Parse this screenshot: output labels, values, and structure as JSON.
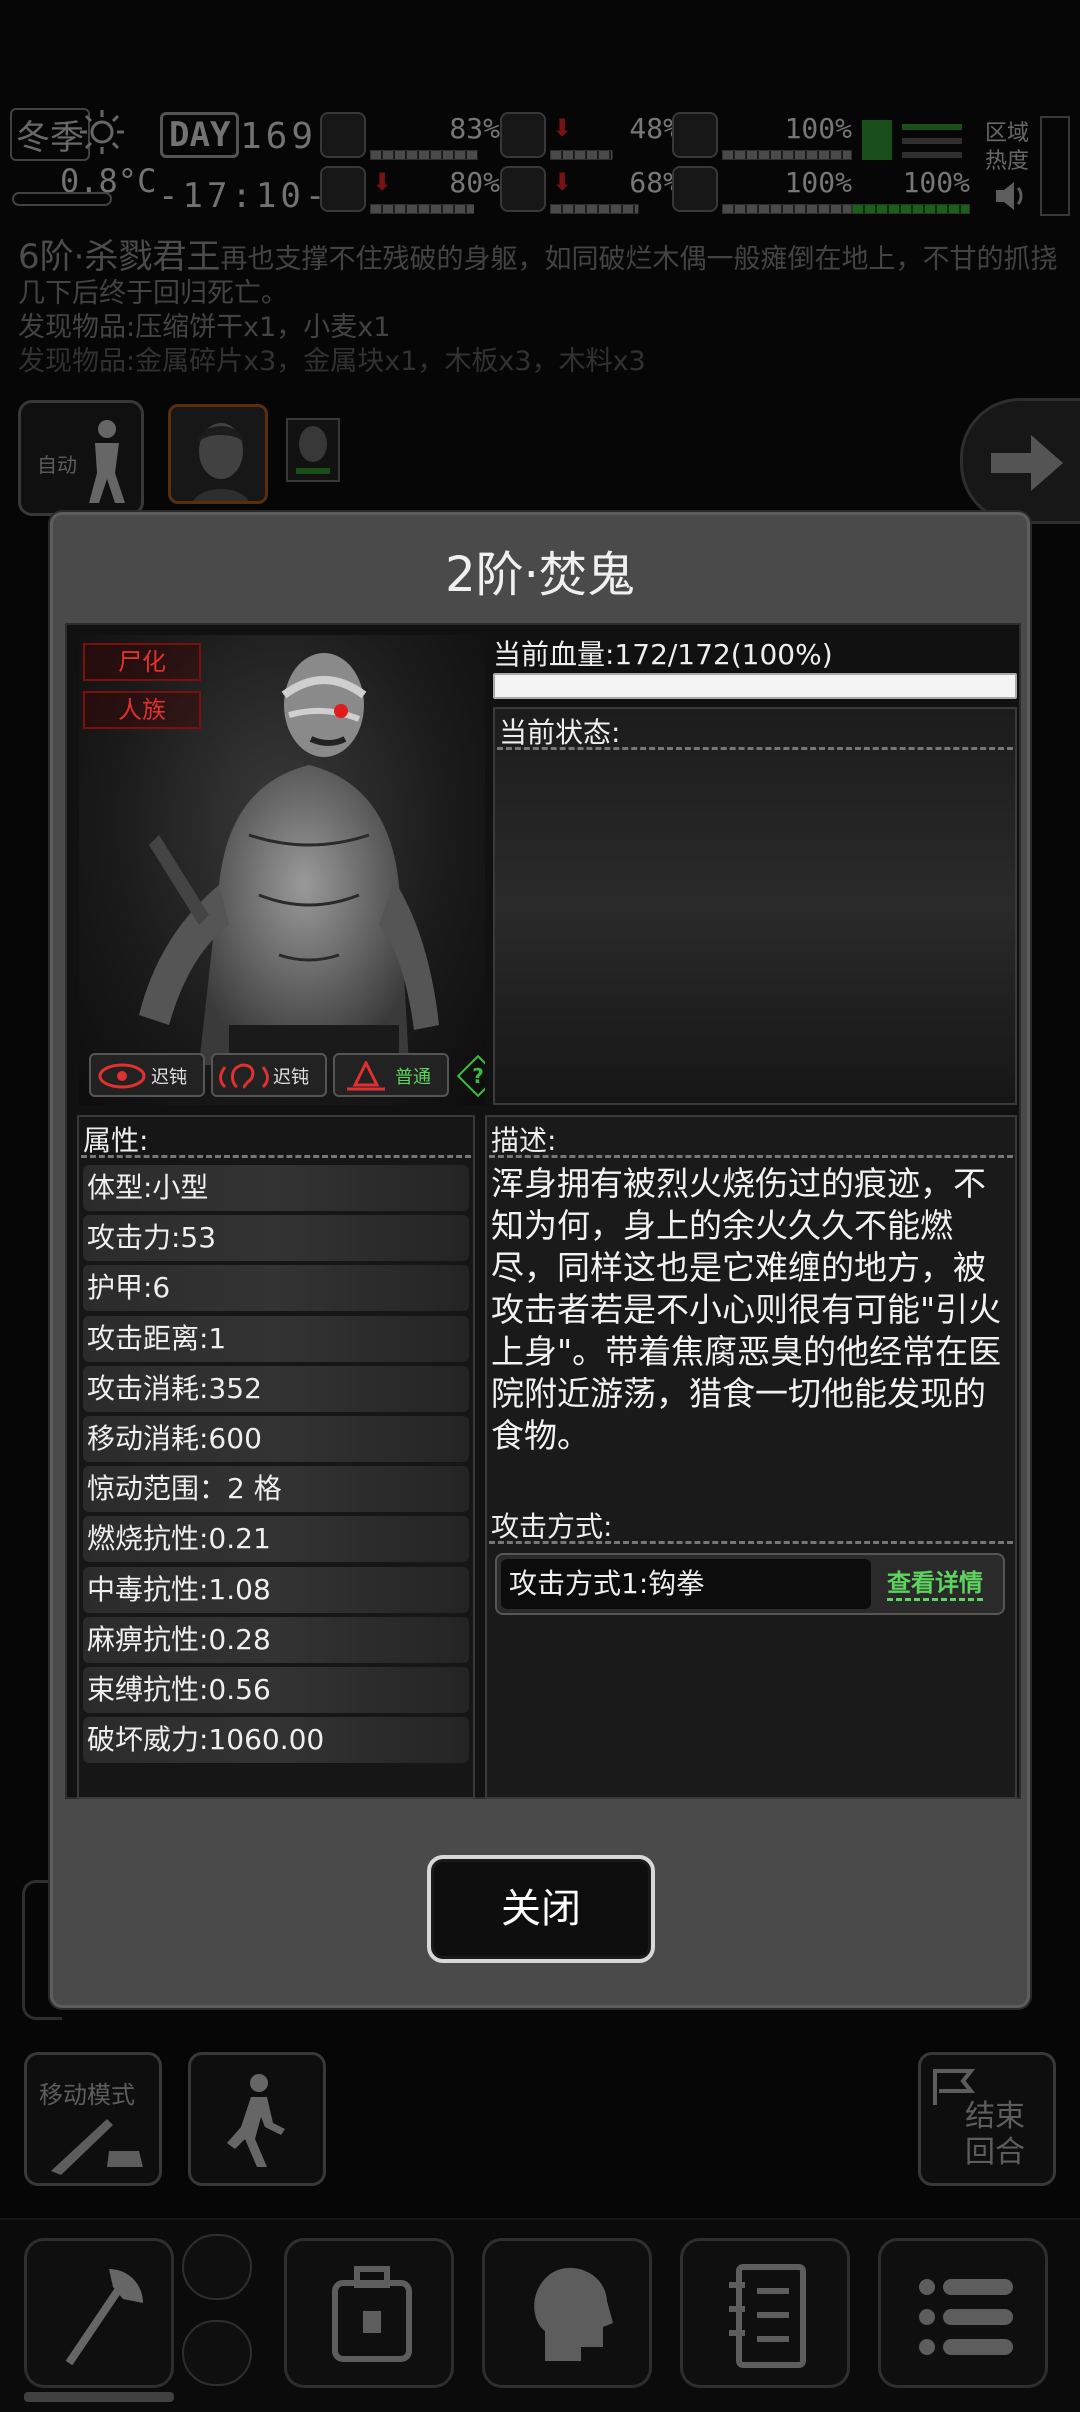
{
  "hud": {
    "season": "冬季",
    "temperature": "0.8°C",
    "day_label": "DAY",
    "day_number": "169",
    "clock": "-17:10-",
    "stats": [
      {
        "icon": "medkit-icon",
        "value": "83%",
        "level": 0.83,
        "trend": ""
      },
      {
        "icon": "stomach-icon",
        "value": "48%",
        "level": 0.48,
        "trend": "down"
      },
      {
        "icon": "stamina-icon",
        "value": "100%",
        "level": 1.0,
        "trend": ""
      },
      {
        "icon": "eye-icon",
        "value": "80%",
        "level": 0.8,
        "trend": "down"
      },
      {
        "icon": "water-drop-icon",
        "value": "68%",
        "level": 0.68,
        "trend": "down"
      },
      {
        "icon": "heart-icon",
        "value": "100%",
        "level": 1.0,
        "trend": ""
      },
      {
        "icon": "green-status-icon",
        "value": "100%",
        "level": 1.0,
        "trend": ""
      }
    ],
    "zone_heat_label": "区域热度"
  },
  "log": {
    "enemy_name": "6阶·杀戮君王",
    "message": "再也支撑不住残破的身躯，如同破烂木偶一般瘫倒在地上，不甘的抓挠几下后终于回归死亡。",
    "found_1": "发现物品:压缩饼干x1，小麦x1",
    "found_2": "发现物品:金属碎片x3，金属块x1，木板x3，木料x3"
  },
  "combat": {
    "auto_label": "自动"
  },
  "controls": {
    "move_mode_label": "移动模式",
    "end_turn_label": "结束回合"
  },
  "modal": {
    "title": "2阶·焚鬼",
    "tags": [
      "尸化",
      "人族"
    ],
    "senses": [
      {
        "icon": "eye-icon",
        "label": "迟钝"
      },
      {
        "icon": "ear-icon",
        "label": "迟钝"
      },
      {
        "icon": "nose-icon",
        "label": "普通"
      }
    ],
    "help_icon": "?",
    "hp_label": "当前血量:172/172(100%)",
    "hp_fraction": 1.0,
    "status_label": "当前状态:",
    "attributes_label": "属性:",
    "attributes": [
      "体型:小型",
      "攻击力:53",
      "护甲:6",
      "攻击距离:1",
      "攻击消耗:352",
      "移动消耗:600",
      "惊动范围：2 格",
      "燃烧抗性:0.21",
      "中毒抗性:1.08",
      "麻痹抗性:0.28",
      "束缚抗性:0.56",
      "破坏威力:1060.00"
    ],
    "description_label": "描述:",
    "description": "浑身拥有被烈火烧伤过的痕迹，不知为何，身上的余火久久不能燃尽，同样这也是它难缠的地方，被攻击者若是不小心则很有可能\"引火上身\"。带着焦腐恶臭的他经常在医院附近游荡，猎食一切他能发现的食物。",
    "attack_label": "攻击方式:",
    "attack_1": "攻击方式1:钩拳",
    "attack_detail": "查看详情",
    "close": "关闭"
  }
}
